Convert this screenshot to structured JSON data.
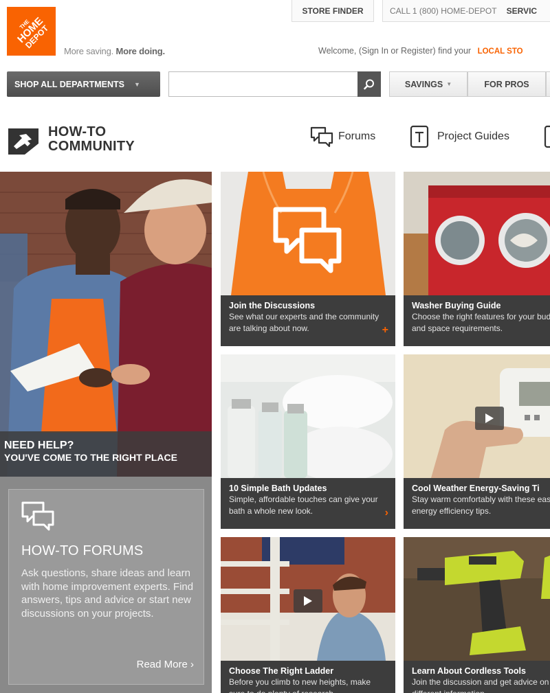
{
  "header": {
    "logo_alt": "THE HOME DEPOT",
    "tagline_light": "More saving.",
    "tagline_bold": "More doing.",
    "store_finder": "STORE FINDER",
    "call": "CALL 1 (800) HOME-DEPOT",
    "service": "SERVIC",
    "welcome": "Welcome, (Sign In or Register) find your",
    "local_store": "LOCAL STO"
  },
  "nav": {
    "shop_all": "SHOP ALL DEPARTMENTS",
    "search_placeholder": "",
    "savings": "SAVINGS",
    "for_pros": "FOR PROS"
  },
  "community": {
    "title_line1": "HOW-TO",
    "title_line2": "COMMUNITY",
    "forums": "Forums",
    "project_guides": "Project Guides"
  },
  "hero": {
    "need_help": "NEED HELP?",
    "right_place": "YOU'VE COME TO THE RIGHT PLACE"
  },
  "forums_panel": {
    "title": "HOW-TO FORUMS",
    "description": "Ask questions, share ideas and learn with home improvement experts. Find answers, tips and advice or start new discussions on your projects.",
    "read_more": "Read More"
  },
  "tiles": [
    {
      "title": "Join the Discussions",
      "desc": "See what our experts and the community are talking about now.",
      "arrow": "+"
    },
    {
      "title": "Washer Buying Guide",
      "desc": "Choose the right features for your budget and space requirements."
    },
    {
      "title": "10 Simple Bath Updates",
      "desc": "Simple, affordable touches can give your bath a whole new look.",
      "arrow": "›"
    },
    {
      "title": "Cool Weather Energy-Saving Ti",
      "desc": "Stay warm comfortably with these easy energy efficiency tips."
    },
    {
      "title": "Choose The Right Ladder",
      "desc": "Before you climb to new heights, make sure to do plenty of research."
    },
    {
      "title": "Learn About Cordless Tools",
      "desc": "Join the discussion and get advice on different information."
    }
  ],
  "colors": {
    "brand_orange": "#f96302",
    "caption_bg": "#3d3d3d",
    "panel_gray": "#898989"
  }
}
